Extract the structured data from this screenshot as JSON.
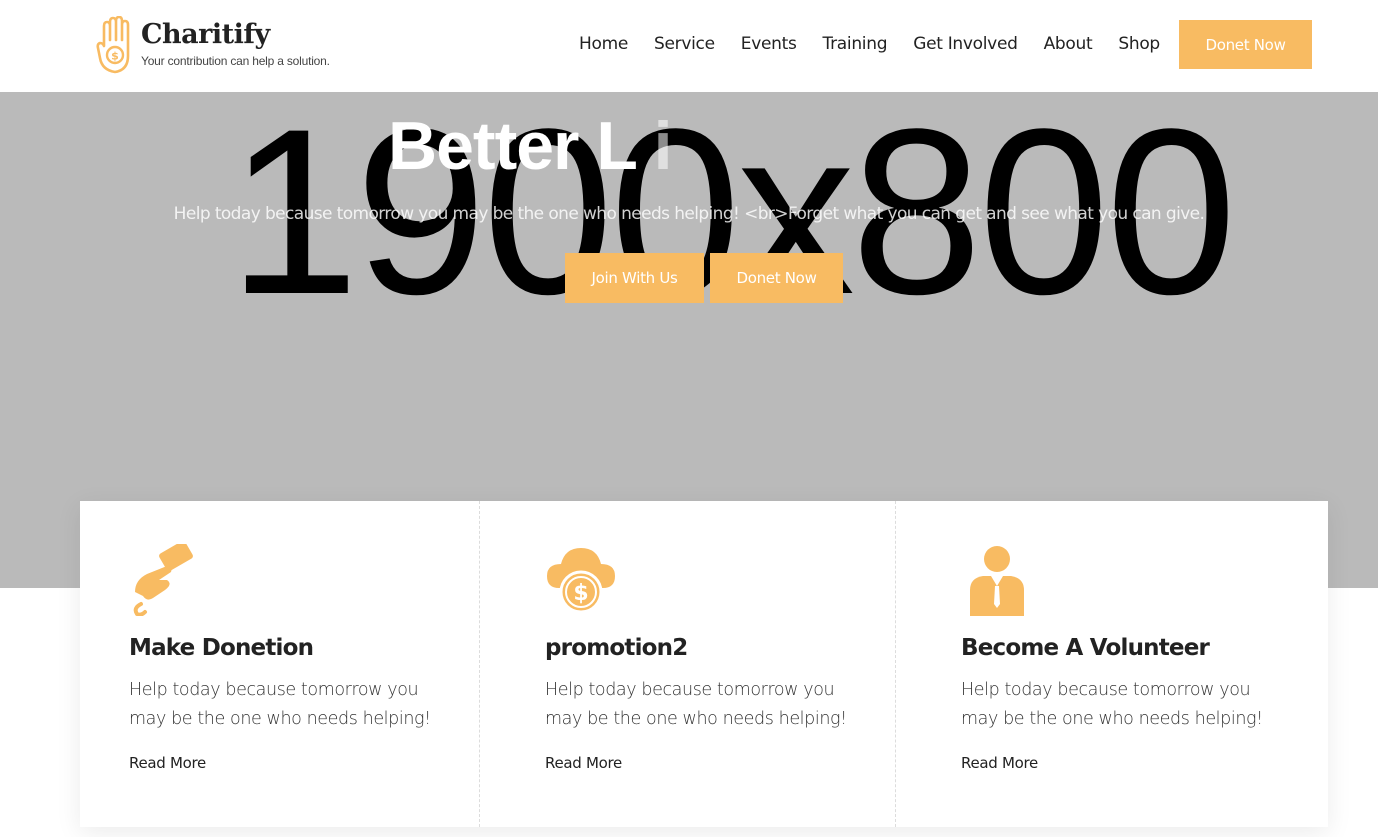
{
  "brand": {
    "name": "Charitify",
    "tagline": "Your contribution can help a solution.",
    "accent_color": "#f8bb62",
    "logo_icon": "hand-coin-icon"
  },
  "nav": {
    "items": [
      {
        "label": "Home"
      },
      {
        "label": "Service"
      },
      {
        "label": "Events"
      },
      {
        "label": "Training"
      },
      {
        "label": "Get Involved"
      },
      {
        "label": "About"
      },
      {
        "label": "Shop"
      }
    ],
    "cta_label": "Donet Now"
  },
  "hero": {
    "placeholder_text": "1900x800",
    "title_main": "Better L",
    "title_faded": "i",
    "subtitle": "Help today because tomorrow you may be the one who needs helping! <br>Forget what you can get and see what you can give.",
    "buttons": {
      "join": "Join With Us",
      "donate": "Donet Now"
    },
    "background_color": "#bababa"
  },
  "cards": [
    {
      "icon": "hand-pen-icon",
      "title": "Make Donetion",
      "text": "Help today because tomorrow you may be the one who needs helping!",
      "link": "Read More"
    },
    {
      "icon": "cloud-dollar-icon",
      "title": "promotion2",
      "text": "Help today because tomorrow you may be the one who needs helping!",
      "link": "Read More"
    },
    {
      "icon": "volunteer-person-icon",
      "title": "Become A Volunteer",
      "text": "Help today because tomorrow you may be the one who needs helping!",
      "link": "Read More"
    }
  ]
}
